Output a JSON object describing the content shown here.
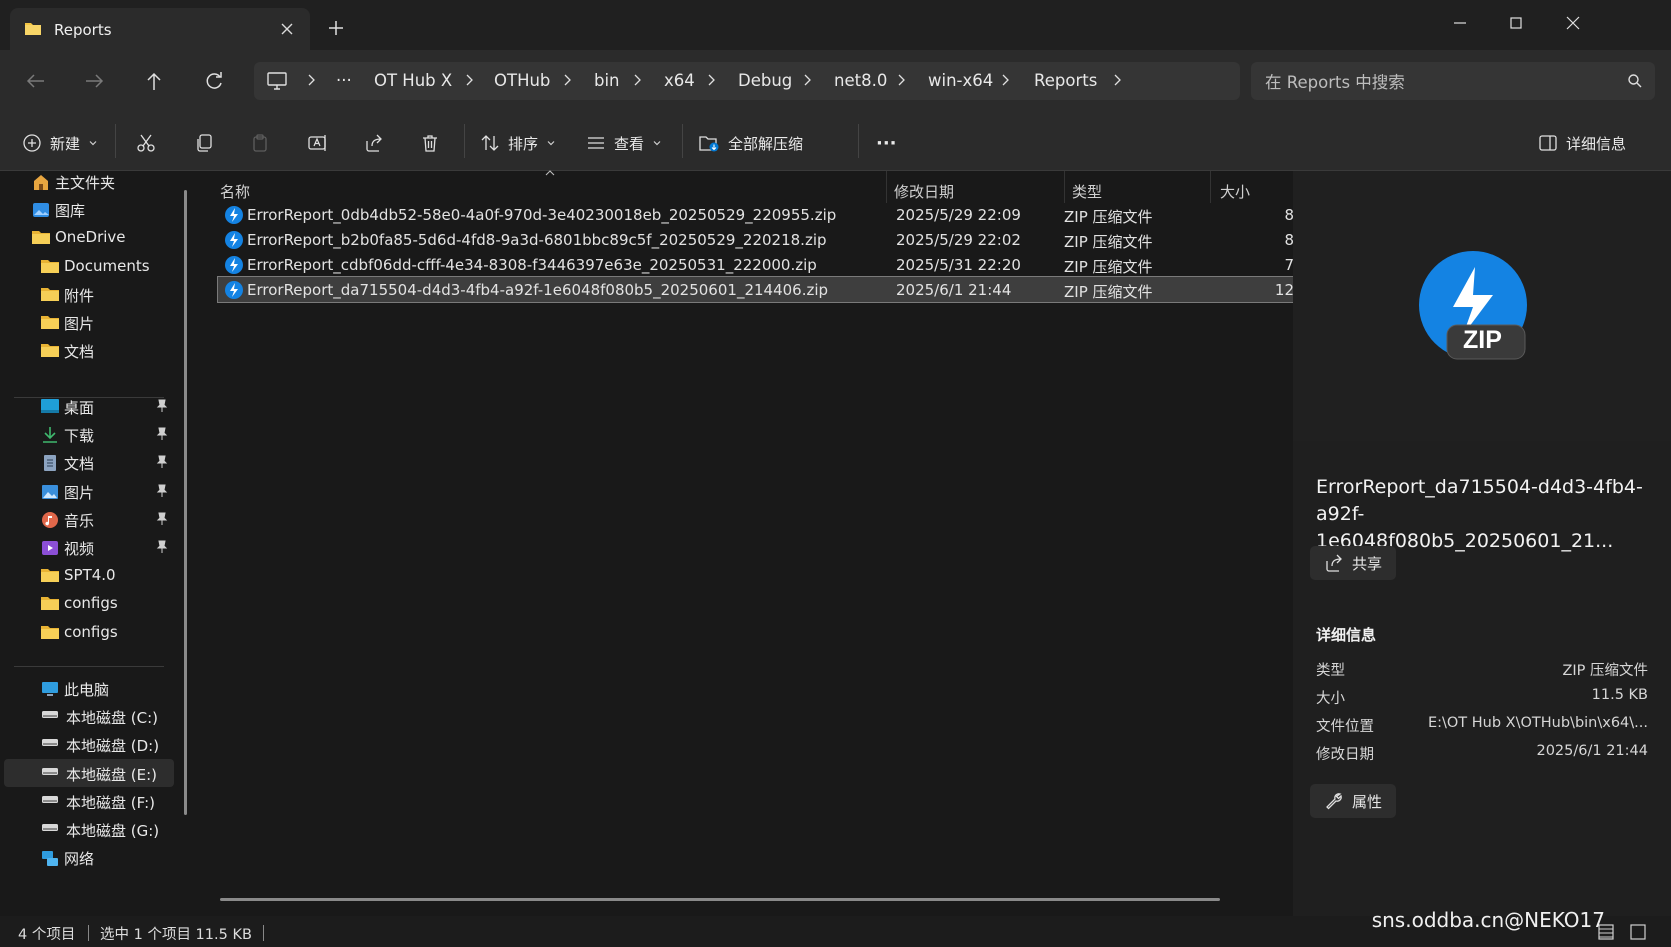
{
  "window": {
    "tab_title": "Reports",
    "icons": [
      "folder-icon",
      "close-icon",
      "plus-icon",
      "minimize-icon",
      "maximize-icon",
      "close-window-icon"
    ]
  },
  "nav": {
    "breadcrumb": [
      "OT Hub X",
      "OTHub",
      "bin",
      "x64",
      "Debug",
      "net8.0",
      "win-x64",
      "Reports"
    ],
    "ellipsis": "···",
    "search_placeholder": "在 Reports 中搜索"
  },
  "toolbar": {
    "new_label": "新建",
    "sort_label": "排序",
    "view_label": "查看",
    "extract_all_label": "全部解压缩",
    "more_label": "···",
    "details_label": "详细信息"
  },
  "sidebar": {
    "groups": [
      [
        {
          "label": "主文件夹",
          "icon": "home-icon"
        },
        {
          "label": "图库",
          "icon": "gallery-icon"
        },
        {
          "label": "OneDrive",
          "icon": "folder-icon"
        },
        {
          "label": "Documents",
          "icon": "folder-icon"
        },
        {
          "label": "附件",
          "icon": "folder-icon"
        },
        {
          "label": "图片",
          "icon": "folder-icon"
        },
        {
          "label": "文档",
          "icon": "folder-icon"
        }
      ],
      [
        {
          "label": "桌面",
          "icon": "desktop-icon",
          "pinned": true
        },
        {
          "label": "下载",
          "icon": "download-icon",
          "pinned": true
        },
        {
          "label": "文档",
          "icon": "document-icon",
          "pinned": true
        },
        {
          "label": "图片",
          "icon": "pictures-icon",
          "pinned": true
        },
        {
          "label": "音乐",
          "icon": "music-icon",
          "pinned": true
        },
        {
          "label": "视频",
          "icon": "video-icon",
          "pinned": true
        },
        {
          "label": "SPT4.0",
          "icon": "folder-icon"
        },
        {
          "label": "configs",
          "icon": "folder-icon"
        },
        {
          "label": "configs",
          "icon": "folder-icon"
        }
      ],
      [
        {
          "label": "此电脑",
          "icon": "computer-icon"
        },
        {
          "label": "本地磁盘 (C:)",
          "icon": "drive-icon"
        },
        {
          "label": "本地磁盘 (D:)",
          "icon": "drive-icon"
        },
        {
          "label": "本地磁盘 (E:)",
          "icon": "drive-icon",
          "selected": true
        },
        {
          "label": "本地磁盘 (F:)",
          "icon": "drive-icon"
        },
        {
          "label": "本地磁盘 (G:)",
          "icon": "drive-icon"
        },
        {
          "label": "网络",
          "icon": "network-icon"
        }
      ]
    ]
  },
  "files": {
    "columns": [
      "名称",
      "修改日期",
      "类型",
      "大小"
    ],
    "rows": [
      {
        "name": "ErrorReport_0db4db52-58e0-4a0f-970d-3e40230018eb_20250529_220955.zip",
        "date": "2025/5/29 22:09",
        "type": "ZIP 压缩文件",
        "size": "8"
      },
      {
        "name": "ErrorReport_b2b0fa85-5d6d-4fd8-9a3d-6801bbc89c5f_20250529_220218.zip",
        "date": "2025/5/29 22:02",
        "type": "ZIP 压缩文件",
        "size": "8"
      },
      {
        "name": "ErrorReport_cdbf06dd-cfff-4e34-8308-f3446397e63e_20250531_222000.zip",
        "date": "2025/5/31 22:20",
        "type": "ZIP 压缩文件",
        "size": "7"
      },
      {
        "name": "ErrorReport_da715504-d4d3-4fb4-a92f-1e6048f080b5_20250601_214406.zip",
        "date": "2025/6/1 21:44",
        "type": "ZIP 压缩文件",
        "size": "12",
        "selected": true
      }
    ]
  },
  "details": {
    "badge": "ZIP",
    "name_line1": "ErrorReport_da715504-d4d3-4fb4-",
    "name_line2": "a92f-1e6048f080b5_20250601_21...",
    "share_label": "共享",
    "section_title": "详细信息",
    "props": [
      {
        "key": "类型",
        "value": "ZIP 压缩文件"
      },
      {
        "key": "大小",
        "value": "11.5 KB"
      },
      {
        "key": "文件位置",
        "value": "E:\\OT Hub X\\OTHub\\bin\\x64\\..."
      },
      {
        "key": "修改日期",
        "value": "2025/6/1 21:44"
      }
    ],
    "properties_label": "属性"
  },
  "status": {
    "count": "4 个项目",
    "selection": "选中 1 个项目  11.5 KB",
    "watermark": "sns.oddba.cn@NEKO17"
  },
  "colors": {
    "accent": "#0078d4",
    "folder": "#f4c542",
    "bg": "#191919",
    "bar": "#2b2b2b"
  }
}
